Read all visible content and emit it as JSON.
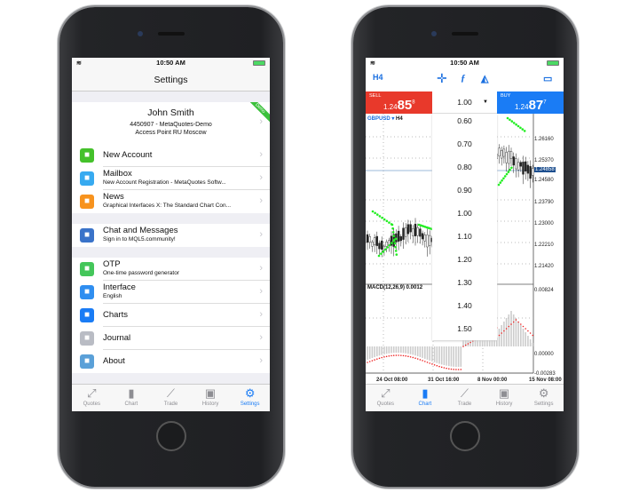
{
  "status": {
    "time": "10:50 AM"
  },
  "settings_screen": {
    "title": "Settings",
    "profile": {
      "name": "John Smith",
      "account": "4450907 - MetaQuotes-Demo",
      "access_point": "Access Point RU Moscow",
      "badge": "Demo"
    },
    "group1": [
      {
        "icon": "add-user-icon",
        "title": "New Account",
        "color": "#44c12b"
      },
      {
        "icon": "mail-icon",
        "title": "Mailbox",
        "subtitle": "New Account Registration - MetaQuotes Softw...",
        "color": "#37aaf0"
      },
      {
        "icon": "news-icon",
        "title": "News",
        "subtitle": "Graphical Interfaces X: The Standard Chart Con...",
        "color": "#f7931e"
      }
    ],
    "group2": [
      {
        "icon": "thumbs-up-icon",
        "title": "Chat and Messages",
        "subtitle": "Sign in to MQL5.community!",
        "color": "#3a73c9"
      }
    ],
    "group3": [
      {
        "icon": "keyhole-icon",
        "title": "OTP",
        "subtitle": "One-time password generator",
        "color": "#44c65a"
      },
      {
        "icon": "translate-icon",
        "title": "Interface",
        "subtitle": "English",
        "color": "#2f8ef0"
      },
      {
        "icon": "candles-icon",
        "title": "Charts",
        "color": "#1a7cf5"
      },
      {
        "icon": "journal-icon",
        "title": "Journal",
        "color": "#b9bcc4"
      },
      {
        "icon": "metatrader-icon",
        "title": "About",
        "color": "#5aa0d8"
      }
    ]
  },
  "tabs": [
    {
      "label": "Quotes",
      "icon": "quotes-icon"
    },
    {
      "label": "Chart",
      "icon": "chart-icon"
    },
    {
      "label": "Trade",
      "icon": "trade-icon"
    },
    {
      "label": "History",
      "icon": "history-icon"
    },
    {
      "label": "Settings",
      "icon": "gear-icon"
    }
  ],
  "chart_screen": {
    "timeframe": "H4",
    "sell": {
      "label": "SELL",
      "price_prefix": "1.24",
      "price_big": "85",
      "price_sup": "8"
    },
    "buy": {
      "label": "BUY",
      "price_prefix": "1.24",
      "price_big": "87",
      "price_sup": "7"
    },
    "volume": "1.00",
    "volume_options": [
      "0.60",
      "0.70",
      "0.80",
      "0.90",
      "1.00",
      "1.10",
      "1.20",
      "1.30",
      "1.40",
      "1.50"
    ],
    "symbol": "GBPUSD",
    "symbol_tf": "H4",
    "indicator": "MACD(12,26,9) 0.0012",
    "price_labels": [
      "1.26160",
      "1.25370",
      "1.24580",
      "1.23790",
      "1.23000",
      "1.22210",
      "1.21420"
    ],
    "current_price": "1.24858",
    "macd_labels": [
      "0.00824",
      "0.00000",
      "-0.00283"
    ],
    "time_labels": [
      "24 Oct 08:00",
      "31 Oct 16:00",
      "8 Nov 00:00",
      "15 Nov 08:00"
    ],
    "colors": {
      "sell": "#e8392b",
      "buy": "#1a7cf5",
      "sar": "#22ee22",
      "signal": "#ee2222"
    }
  }
}
